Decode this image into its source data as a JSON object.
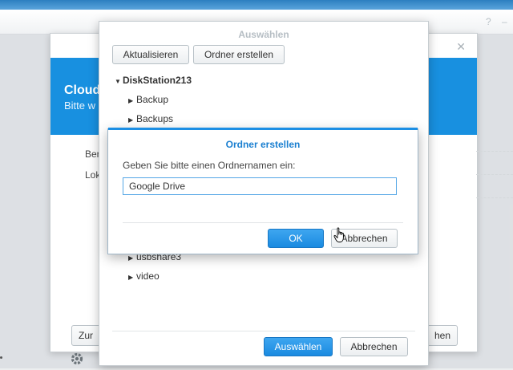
{
  "background_window": {
    "title": "Cloud",
    "subtitle": "Bitte w",
    "label1": "Ber",
    "label2": "Lok",
    "back_button": "Zur",
    "cancel_button_partial": "hen"
  },
  "select_dialog": {
    "title": "Auswählen",
    "refresh_button": "Aktualisieren",
    "create_folder_button": "Ordner erstellen",
    "tree": {
      "root": "DiskStation213",
      "children_top": [
        "Backup",
        "Backups"
      ],
      "children_bottom": [
        "usbshare3",
        "video"
      ]
    },
    "select_button": "Auswählen",
    "cancel_button": "Abbrechen"
  },
  "create_dialog": {
    "title": "Ordner erstellen",
    "prompt": "Geben Sie bitte einen Ordnernamen ein:",
    "folder_name_value": "Google Drive",
    "ok_button": "OK",
    "cancel_button": "Abbrechen"
  },
  "colors": {
    "accent": "#1890e0",
    "primary_button": "#1a8ae0"
  }
}
